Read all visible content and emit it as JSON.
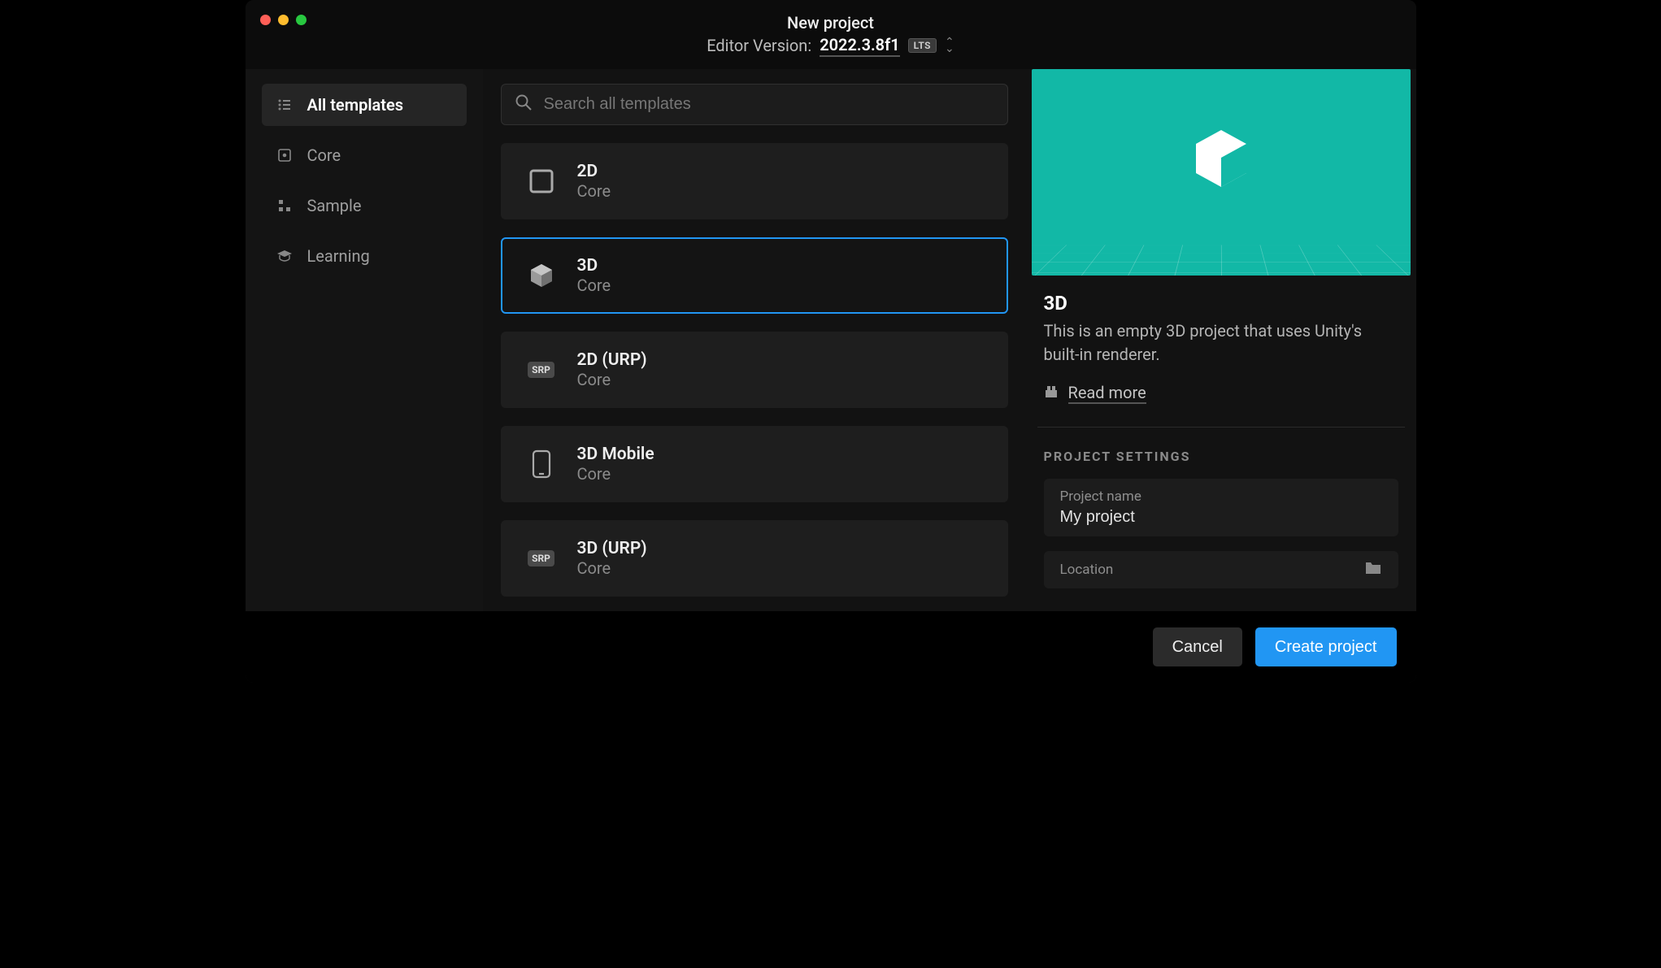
{
  "window": {
    "title": "New project",
    "editor_label": "Editor Version:",
    "editor_version": "2022.3.8f1",
    "lts_badge": "LTS"
  },
  "sidebar": {
    "items": [
      {
        "label": "All templates",
        "icon": "list-icon",
        "active": true
      },
      {
        "label": "Core",
        "icon": "square-dot-icon",
        "active": false
      },
      {
        "label": "Sample",
        "icon": "grid-dots-icon",
        "active": false
      },
      {
        "label": "Learning",
        "icon": "graduation-icon",
        "active": false
      }
    ]
  },
  "search": {
    "placeholder": "Search all templates"
  },
  "templates": [
    {
      "title": "2D",
      "subtitle": "Core",
      "icon": "square-outline",
      "selected": false
    },
    {
      "title": "3D",
      "subtitle": "Core",
      "icon": "cube",
      "selected": true
    },
    {
      "title": "2D (URP)",
      "subtitle": "Core",
      "icon": "srp",
      "selected": false
    },
    {
      "title": "3D Mobile",
      "subtitle": "Core",
      "icon": "mobile",
      "selected": false
    },
    {
      "title": "3D (URP)",
      "subtitle": "Core",
      "icon": "srp",
      "selected": false
    }
  ],
  "detail": {
    "title": "3D",
    "description": "This is an empty 3D project that uses Unity's built-in renderer.",
    "read_more": "Read more",
    "settings_header": "PROJECT SETTINGS",
    "project_name_label": "Project name",
    "project_name_value": "My project",
    "location_label": "Location"
  },
  "footer": {
    "cancel": "Cancel",
    "create": "Create project"
  }
}
